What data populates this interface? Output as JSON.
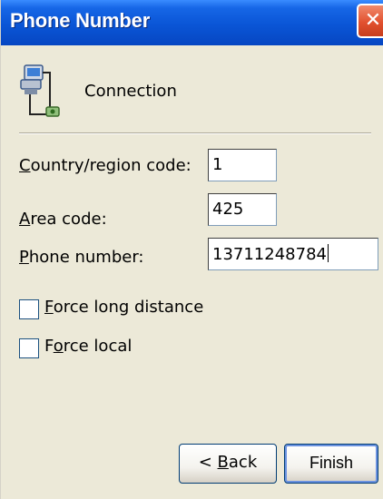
{
  "window": {
    "title": "Phone Number",
    "close_glyph": "✕"
  },
  "header": {
    "title": "Connection",
    "icon": "network-connection-icon"
  },
  "form": {
    "country_code": {
      "label_pre": "",
      "label_accel": "C",
      "label_post": "ountry/region code:",
      "value": "1"
    },
    "area_code": {
      "label_pre": "",
      "label_accel": "A",
      "label_post": "rea code:",
      "value": "425"
    },
    "phone_number": {
      "label_pre": "",
      "label_accel": "P",
      "label_post": "hone number:",
      "value": "13711248784"
    }
  },
  "options": {
    "force_long_distance": {
      "label_pre": "",
      "label_accel": "F",
      "label_post": "orce long distance",
      "checked": false
    },
    "force_local": {
      "label_pre": "F",
      "label_accel": "o",
      "label_post": "rce local",
      "checked": false
    }
  },
  "buttons": {
    "back": {
      "pre": "< ",
      "accel": "B",
      "post": "ack"
    },
    "finish": {
      "label": "Finish"
    }
  },
  "colors": {
    "titlebar": "#0a55d6",
    "close": "#e2512f",
    "dialog_bg": "#ece9d8"
  }
}
